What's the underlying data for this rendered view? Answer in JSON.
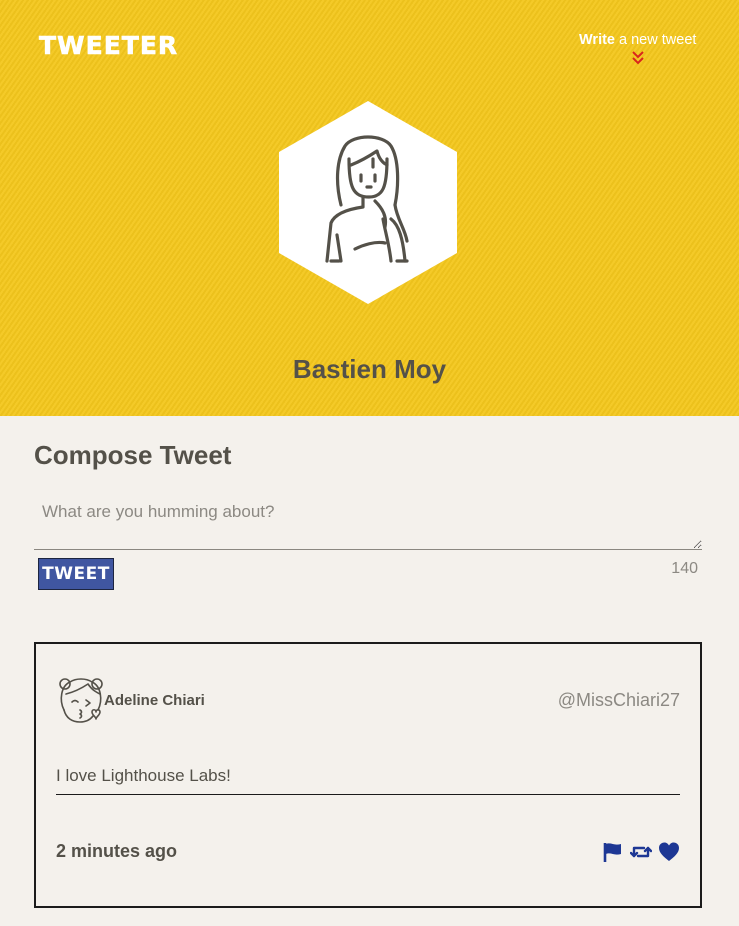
{
  "header": {
    "logo_text": "TWEETER",
    "write_link": {
      "bold": "Write",
      "rest": " a new tweet"
    },
    "chevron_icon": "double-chevron-down-icon",
    "chevron_color": "#d9261c",
    "background_color": "#f4c71d",
    "user_name": "Bastien Moy"
  },
  "compose": {
    "title": "Compose Tweet",
    "placeholder": "What are you humming about?",
    "value": "",
    "button_label": "TWEET",
    "button_color": "#4056a1",
    "char_counter": "140"
  },
  "tweets": [
    {
      "name": "Adeline Chiari",
      "handle": "@MissChiari27",
      "text": "I love Lighthouse Labs!",
      "time": "2 minutes ago",
      "actions": [
        "flag-icon",
        "retweet-icon",
        "heart-icon"
      ],
      "action_color": "#1d3794"
    }
  ]
}
